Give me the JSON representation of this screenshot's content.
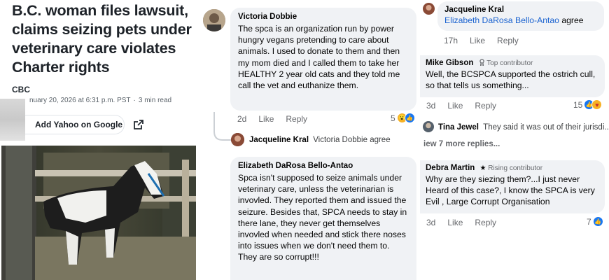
{
  "article": {
    "headline": "B.C. woman files lawsuit, claims seizing pets under veterinary care violates Charter rights",
    "source": "CBC",
    "date": "nuary 20, 2026 at 6:31 p.m. PST",
    "read_time": "3 min read",
    "add_yahoo_label": "Add Yahoo on Google"
  },
  "comments_middle": {
    "c1": {
      "author": "Victoria Dobbie",
      "text": "The spca is an organization run by power hungry vegans pretending to care about animals. I used to donate to them and then my mom died and I called them to take her HEALTHY 2 year old cats and they told me call the vet and euthanize them.",
      "time": "2d",
      "like": "Like",
      "reply": "Reply",
      "reaction_count": "5"
    },
    "c2": {
      "author": "Jacqueline Kral",
      "text": "Victoria Dobbie agree"
    },
    "c3": {
      "author": "Elizabeth DaRosa Bello-Antao",
      "text": "Spca isn't supposed to seize animals under veterinary care, unless the veterinarian is invovled. They reported them and issued the seizure. Besides that, SPCA needs to stay in there lane, they never get themselves invovled when needed and stick there noses into issues when we don't need them to. They are so corrupt!!!"
    }
  },
  "comments_right": {
    "c1": {
      "author": "Jacqueline Kral",
      "mention": "Elizabeth DaRosa Bello-Antao",
      "text": "agree",
      "time": "17h",
      "like": "Like",
      "reply": "Reply"
    },
    "c2": {
      "author": "Mike Gibson",
      "badge": "Top contributor",
      "text": "Well, the BCSPCA supported the ostrich cull, so that tells us something...",
      "time": "3d",
      "like": "Like",
      "reply": "Reply",
      "reaction_count": "15"
    },
    "c3": {
      "author": "Tina Jewel",
      "text": "They said it was out of their jurisdi..."
    },
    "more_replies": "iew 7 more replies...",
    "c4": {
      "author": "Debra Martin",
      "badge": "Rising contributor",
      "text": "Why are they siezing them?...I just never Heard of this case?, I know the SPCA is very Evil , Large Corrupt Organisation",
      "time": "3d",
      "like": "Like",
      "reply": "Reply",
      "reaction_count": "7"
    }
  },
  "colors": {
    "bubble": "#f0f2f5",
    "link": "#1b63d0",
    "like_blue": "#1877f2",
    "muted": "#65676b"
  },
  "icons": [
    "share-icon",
    "like-reaction-icon",
    "wow-reaction-icon",
    "care-reaction-icon",
    "badge-icon",
    "star-badge-icon"
  ]
}
